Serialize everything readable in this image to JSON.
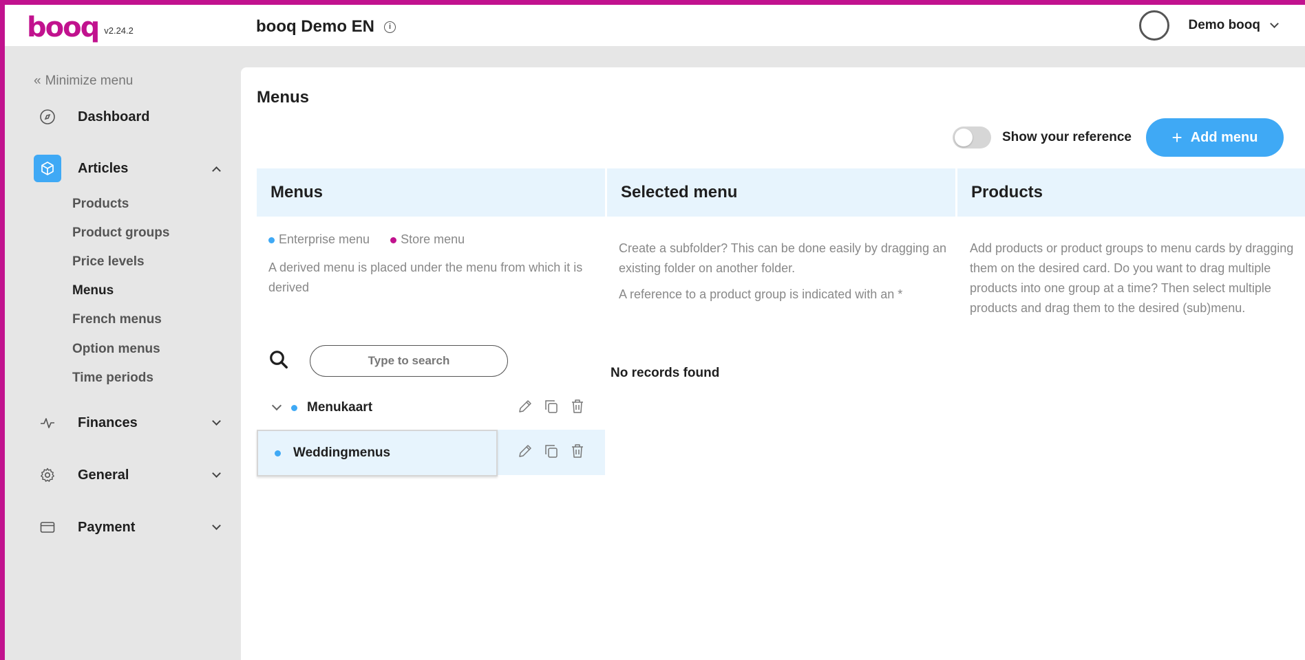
{
  "app": {
    "logo_text": "booq",
    "version": "v2.24.2",
    "company_name": "booq Demo EN",
    "user_name": "Demo booq",
    "accent_color": "#3fa9f5",
    "brand_color": "#c1128e"
  },
  "sidebar": {
    "minimize_label": "Minimize menu",
    "items": [
      {
        "label": "Dashboard",
        "icon": "compass-icon"
      },
      {
        "label": "Articles",
        "icon": "box-icon",
        "expanded": true,
        "children": [
          "Products",
          "Product groups",
          "Price levels",
          "Menus",
          "French menus",
          "Option menus",
          "Time periods"
        ]
      },
      {
        "label": "Finances",
        "icon": "pulse-icon"
      },
      {
        "label": "General",
        "icon": "gear-icon"
      },
      {
        "label": "Payment",
        "icon": "card-icon"
      }
    ],
    "active_child": "Menus"
  },
  "main": {
    "title": "Menus",
    "show_reference_label": "Show your reference",
    "show_reference_on": false,
    "add_menu_label": "Add menu",
    "columns": {
      "menus": {
        "title": "Menus",
        "legend_enterprise": "Enterprise menu",
        "legend_store": "Store menu",
        "desc": "A derived menu is placed under the menu from which it is derived",
        "search_placeholder": "Type to search",
        "rows": [
          {
            "name": "Menukaart",
            "type": "enterprise",
            "expandable": true
          },
          {
            "name": "Weddingmenus",
            "type": "enterprise",
            "selected": true
          }
        ]
      },
      "selected": {
        "title": "Selected menu",
        "desc_1": "Create a subfolder? This can be done easily by dragging an existing folder on another folder.",
        "desc_2": "A reference to a product group is indicated with an *",
        "empty": "No records found"
      },
      "products": {
        "title": "Products",
        "desc": "Add products or product groups to menu cards by dragging them on the desired card. Do you want to drag multiple products into one group at a time? Then select multiple products and drag them to the desired (sub)menu."
      }
    }
  }
}
